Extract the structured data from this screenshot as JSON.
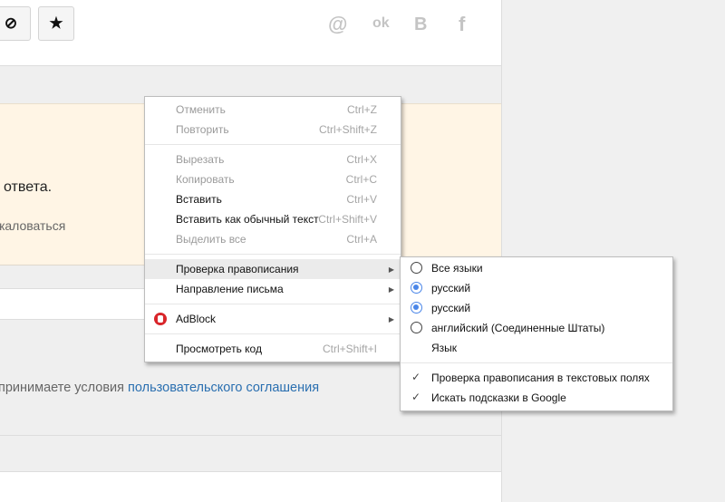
{
  "toolbar": {
    "block_icon": "⊘",
    "star_icon": "★"
  },
  "social": {
    "mail": "@",
    "ok": "ok",
    "vk": "B",
    "fb": "f"
  },
  "notice": {
    "line1": "ответа.",
    "line2": "жаловаться"
  },
  "terms": {
    "prefix": "принимаете условия ",
    "link": "пользовательского соглашения"
  },
  "context_menu": {
    "undo": {
      "label": "Отменить",
      "shortcut": "Ctrl+Z"
    },
    "redo": {
      "label": "Повторить",
      "shortcut": "Ctrl+Shift+Z"
    },
    "cut": {
      "label": "Вырезать",
      "shortcut": "Ctrl+X"
    },
    "copy": {
      "label": "Копировать",
      "shortcut": "Ctrl+C"
    },
    "paste": {
      "label": "Вставить",
      "shortcut": "Ctrl+V"
    },
    "paste_plain": {
      "label": "Вставить как обычный текст",
      "shortcut": "Ctrl+Shift+V"
    },
    "select_all": {
      "label": "Выделить все",
      "shortcut": "Ctrl+A"
    },
    "spellcheck": {
      "label": "Проверка правописания"
    },
    "direction": {
      "label": "Направление письма"
    },
    "adblock": {
      "label": "AdBlock"
    },
    "inspect": {
      "label": "Просмотреть код",
      "shortcut": "Ctrl+Shift+I"
    }
  },
  "spell_submenu": {
    "all_languages": "Все языки",
    "russian1": "русский",
    "russian2": "русский",
    "english_us": "английский (Соединенные Штаты)",
    "language": "Язык",
    "check_fields": "Проверка правописания в текстовых полях",
    "google_hints": "Искать подсказки в Google"
  },
  "colors": {
    "link": "#2a6fb0",
    "notice_bg": "#fff5e5",
    "radio_on": "#4a86e8"
  }
}
